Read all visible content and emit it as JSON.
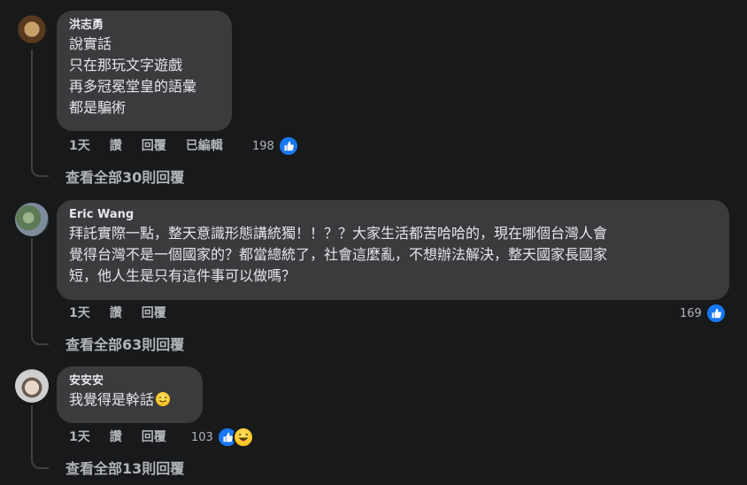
{
  "comments": [
    {
      "author": "洪志勇",
      "lines": [
        "說實話",
        "只在那玩文字遊戲",
        "再多冠冕堂皇的語彙",
        "都是騙術"
      ],
      "time": "1天",
      "like_label": "讚",
      "reply_label": "回覆",
      "edited_label": "已編輯",
      "reaction_count": "198",
      "reactions": [
        "like-icon"
      ],
      "view_replies": "查看全部30則回覆"
    },
    {
      "author": "Eric Wang",
      "lines": [
        "拜託實際一點，整天意識形態講統獨！！？？大家生活都苦哈哈的，現在哪個台灣人會",
        "覺得台灣不是一個國家的？都當總統了，社會這麼亂，不想辦法解決，整天國家長國家",
        "短，他人生是只有這件事可以做嗎？"
      ],
      "time": "1天",
      "like_label": "讚",
      "reply_label": "回覆",
      "reaction_count": "169",
      "reactions": [
        "like-icon"
      ],
      "view_replies": "查看全部63則回覆"
    },
    {
      "author": "安安安",
      "lines": [
        "我覺得是幹話"
      ],
      "inline_emoji": "sweat-smile-emoji",
      "time": "1天",
      "like_label": "讚",
      "reply_label": "回覆",
      "reaction_count": "103",
      "reactions": [
        "like-icon",
        "haha-icon"
      ],
      "view_replies": "查看全部13則回覆"
    }
  ],
  "colors": {
    "background": "#18191a",
    "bubble": "#3a3b3c",
    "text": "#e4e6eb",
    "secondary_text": "#b0b3b8",
    "like_blue": "#1877f2"
  }
}
